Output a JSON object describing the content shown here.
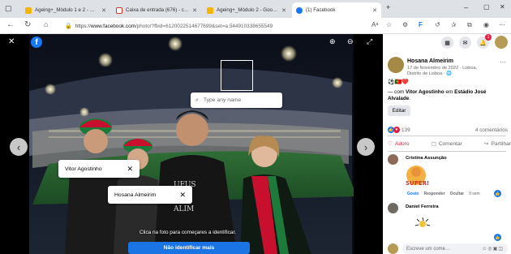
{
  "browser": {
    "tabs": [
      {
        "title": "Ageing+_Módulo 1 e 2 - Google",
        "icon": "slides-icon",
        "color": "#f4b400",
        "active": false
      },
      {
        "title": "Caixa de entrada (676) - chanan",
        "icon": "gmail-icon",
        "color": "#d93025",
        "active": false
      },
      {
        "title": "Ageing+_Módulo 2 - Google Sli",
        "icon": "slides-icon",
        "color": "#f4b400",
        "active": false
      },
      {
        "title": "(1) Facebook",
        "icon": "facebook-icon",
        "color": "#1877f2",
        "active": true
      }
    ],
    "url_prefix": "https://",
    "url_host": "www.facebook.com",
    "url_path": "/photo/?fbid=612002251467769​9&set=a.544910338655549"
  },
  "photo": {
    "search_placeholder": "Type any name",
    "tags": [
      {
        "name": "Vitor Agostinho"
      },
      {
        "name": "Hosana Almeirim"
      }
    ],
    "hint": "Clica na foto para começares a identificar.",
    "done_label": "Não identificar mais"
  },
  "post": {
    "author": "Hosana Almeirim",
    "date": "17 de Novembro de 2022 · Lisboa, Distrito de Lisboa ·",
    "emojis": "⚽🇵🇹❤️",
    "with_prefix": "— com",
    "with_name": "Vitor Agostinho",
    "at_word": "em",
    "place": "Estádio José Alvalade",
    "place_suffix": ".",
    "edit_label": "Editar",
    "reaction_count": "139",
    "comment_count": "4 comentários",
    "actions": {
      "like": "Adoro",
      "comment": "Comentar",
      "share": "Partilhar"
    },
    "comments": [
      {
        "name": "Cristina Assunção",
        "sticker_text": "SUPER!",
        "links": [
          "Gosto",
          "Responder",
          "Ocultar",
          "9 sem"
        ]
      },
      {
        "name": "Daniel Ferreira"
      }
    ],
    "comment_placeholder": "Escreve um come…"
  },
  "colors": {
    "accent": "#1877f2",
    "love": "#e41e3f",
    "done_button": "#1b74e4"
  }
}
